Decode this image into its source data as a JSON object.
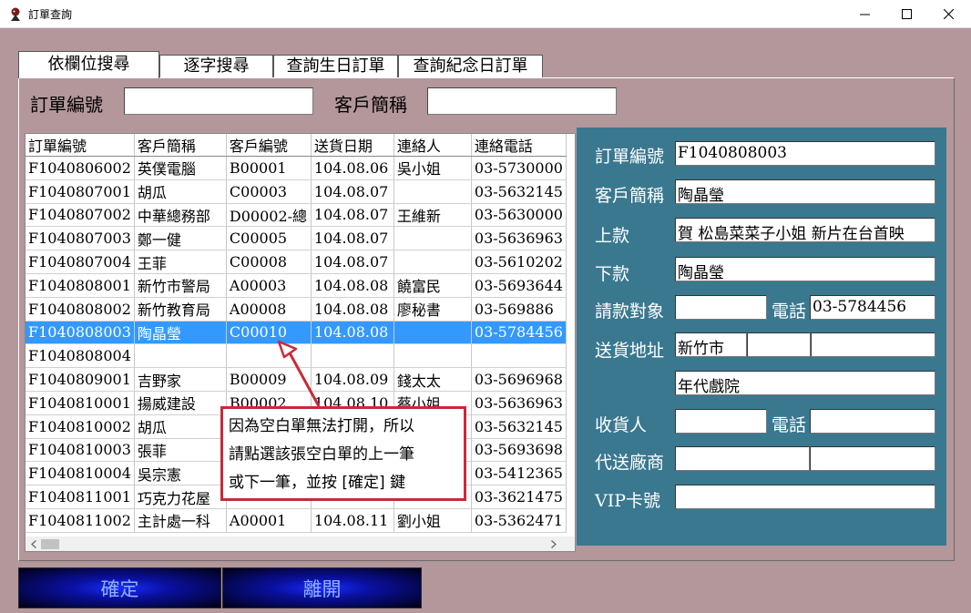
{
  "window": {
    "title": "訂單查詢"
  },
  "tabs": [
    {
      "label": "依欄位搜尋"
    },
    {
      "label": "逐字搜尋"
    },
    {
      "label": "查詢生日訂單"
    },
    {
      "label": "查詢紀念日訂單"
    }
  ],
  "search": {
    "order_no_label": "訂單編號",
    "order_no_value": "",
    "customer_label": "客戶簡稱",
    "customer_value": ""
  },
  "grid": {
    "columns": [
      "訂單編號",
      "客戶簡稱",
      "客戶編號",
      "送貨日期",
      "連絡人",
      "連絡電話"
    ],
    "rows": [
      [
        "F1040806002",
        "英僕電腦",
        "B00001",
        "104.08.06",
        "吳小姐",
        "03-5730000"
      ],
      [
        "F1040807001",
        "胡瓜",
        "C00003",
        "104.08.07",
        "",
        "03-5632145"
      ],
      [
        "F1040807002",
        "中華總務部",
        "D00002-總",
        "104.08.07",
        "王維新",
        "03-5630000"
      ],
      [
        "F1040807003",
        "鄭一健",
        "C00005",
        "104.08.07",
        "",
        "03-5636963"
      ],
      [
        "F1040807004",
        "王菲",
        "C00008",
        "104.08.07",
        "",
        "03-5610202"
      ],
      [
        "F1040808001",
        "新竹市警局",
        "A00003",
        "104.08.08",
        "饒富民",
        "03-5693644"
      ],
      [
        "F1040808002",
        "新竹教育局",
        "A00008",
        "104.08.08",
        "廖秘書",
        "03-569886"
      ],
      [
        "F1040808003",
        "陶晶瑩",
        "C00010",
        "104.08.08",
        "",
        "03-5784456"
      ],
      [
        "F1040808004",
        "",
        "",
        "",
        "",
        ""
      ],
      [
        "F1040809001",
        "吉野家",
        "B00009",
        "104.08.09",
        "錢太太",
        "03-5696968"
      ],
      [
        "F1040810001",
        "揚威建設",
        "B00002",
        "104.08.10",
        "蔡小姐",
        "03-5636963"
      ],
      [
        "F1040810002",
        "胡瓜",
        "",
        "",
        "",
        "03-5632145"
      ],
      [
        "F1040810003",
        "張菲",
        "",
        "",
        "",
        "03-5693698"
      ],
      [
        "F1040810004",
        "吳宗憲",
        "",
        "",
        "",
        "03-5412365"
      ],
      [
        "F1040811001",
        "巧克力花屋",
        "",
        "",
        "",
        "03-3621475"
      ],
      [
        "F1040811002",
        "主計處一科",
        "A00001",
        "104.08.11",
        "劉小姐",
        "03-5362471"
      ]
    ],
    "selected_index": 7
  },
  "callout": {
    "line1": "因為空白單無法打開，所以",
    "line2": "請點選該張空白單的上一筆",
    "line3": "或下一筆，並按 [確定] 鍵",
    "color": "#c82a3a"
  },
  "detail": {
    "order_no_label": "訂單編號",
    "order_no": "F1040808003",
    "customer_label": "客戶簡稱",
    "customer": "陶晶瑩",
    "upper_label": "上款",
    "upper": "賀 松島菜菜子小姐  新片在台首映",
    "lower_label": "下款",
    "lower": "陶晶瑩",
    "billing_label": "請款對象",
    "billing": "",
    "phone_label": "電話",
    "phone": "03-5784456",
    "address_label": "送貨地址",
    "address_city": "新竹市",
    "address_2": "",
    "address_3": "",
    "address_line2": "年代戲院",
    "receiver_label": "收貨人",
    "receiver": "",
    "receiver_phone_label": "電話",
    "receiver_phone": "",
    "agent_label": "代送廠商",
    "agent_1": "",
    "agent_2": "",
    "vip_label": "VIP卡號",
    "vip": ""
  },
  "buttons": {
    "ok": "確定",
    "exit": "離開"
  },
  "colors": {
    "selected_row": "#3399ff",
    "detail_bg": "#3a7890",
    "window_bg": "#b3979b"
  },
  "icons": {
    "app": "app-icon",
    "minimize": "minimize-icon",
    "maximize": "maximize-icon",
    "close": "close-icon"
  }
}
